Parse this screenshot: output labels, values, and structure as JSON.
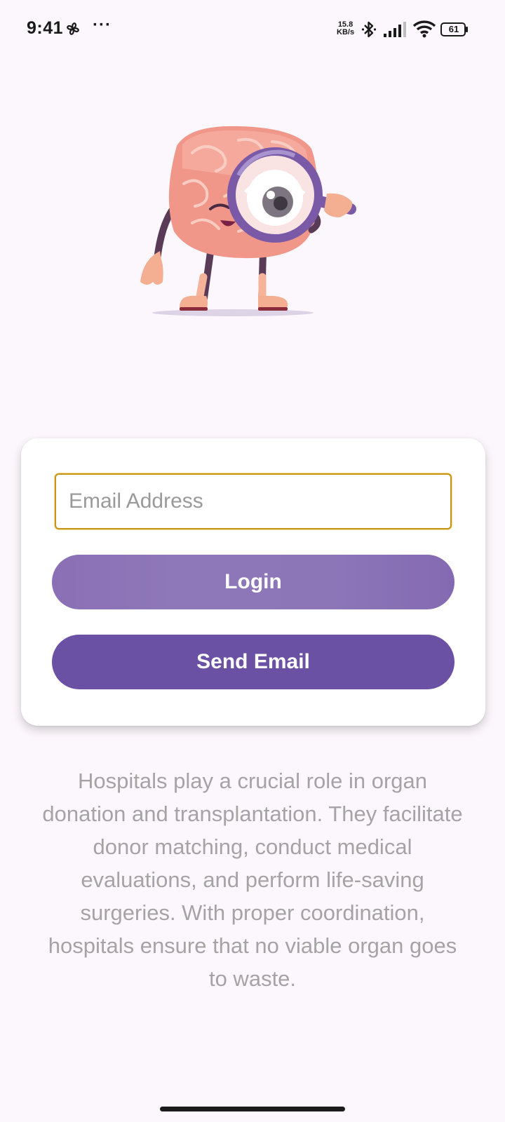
{
  "status_bar": {
    "time": "9:41",
    "more": "···",
    "net_speed_value": "15.8",
    "net_speed_unit": "KB/s",
    "battery_level": "61",
    "icons": [
      "fan-icon",
      "bluetooth-icon",
      "signal-icon",
      "wifi-icon",
      "battery-icon"
    ]
  },
  "illustration": {
    "icon": "brain-magnifier-illustration"
  },
  "login_card": {
    "email_placeholder": "Email Address",
    "email_value": "",
    "login_label": "Login",
    "send_email_label": "Send Email"
  },
  "info_text": "Hospitals play a crucial role in organ donation and transplantation. They facilitate donor matching, conduct medical evaluations, and perform life-saving surgeries. With proper coordination, hospitals ensure that no viable organ goes to waste.",
  "colors": {
    "background": "#fcf7fc",
    "input_border": "#c79416",
    "login_button": "#8b72b6",
    "send_button": "#6a51a3",
    "info_text": "#a6a3a6"
  }
}
